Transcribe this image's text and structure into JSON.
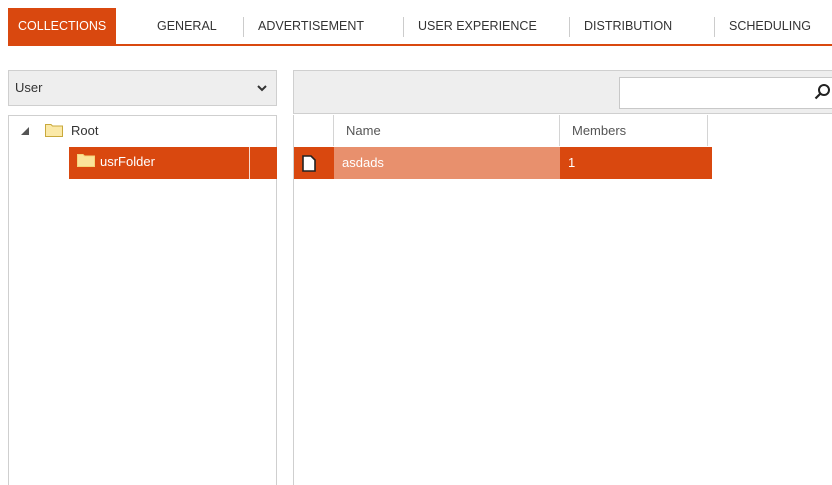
{
  "tabs": [
    {
      "label": "COLLECTIONS",
      "active": true
    },
    {
      "label": "GENERAL",
      "active": false
    },
    {
      "label": "ADVERTISEMENT",
      "active": false
    },
    {
      "label": "USER EXPERIENCE",
      "active": false
    },
    {
      "label": "DISTRIBUTION",
      "active": false
    },
    {
      "label": "SCHEDULING",
      "active": false
    }
  ],
  "collection_type": {
    "selected": "User"
  },
  "tree": {
    "root_label": "Root",
    "children": [
      {
        "label": "usrFolder",
        "selected": true
      }
    ]
  },
  "search": {
    "value": "",
    "placeholder": ""
  },
  "grid": {
    "columns": [
      "Name",
      "Members"
    ],
    "rows": [
      {
        "name": "asdads",
        "members": "1",
        "selected": true
      }
    ]
  },
  "colors": {
    "accent": "#d9480f",
    "selected_cell": "#e8906d",
    "panel_bg": "#eeeeee",
    "border": "#cfcfcf"
  }
}
